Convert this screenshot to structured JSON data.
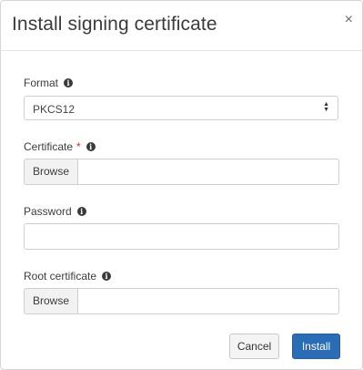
{
  "dialog": {
    "title": "Install signing certificate",
    "close_icon": "×"
  },
  "format": {
    "label": "Format",
    "value": "PKCS12"
  },
  "certificate": {
    "label": "Certificate",
    "required_marker": "*",
    "browse_label": "Browse"
  },
  "password": {
    "label": "Password"
  },
  "root_certificate": {
    "label": "Root certificate",
    "browse_label": "Browse"
  },
  "info_icon": "i",
  "buttons": {
    "cancel": "Cancel",
    "install": "Install"
  },
  "colors": {
    "primary": "#2a6cb5",
    "required": "#c9302c"
  }
}
